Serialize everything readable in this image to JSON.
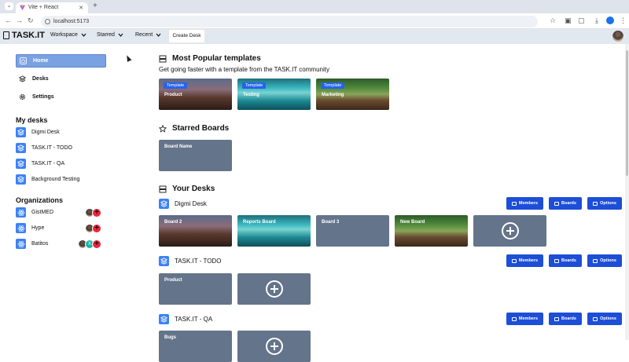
{
  "browser": {
    "tab_title": "Vite + React",
    "url": "localhost:5173"
  },
  "header": {
    "logo": "TASK.IT",
    "menus": [
      {
        "label": "Workspace"
      },
      {
        "label": "Starred"
      },
      {
        "label": "Recent"
      }
    ],
    "create_label": "Create Desk"
  },
  "sidebar": {
    "nav": [
      {
        "label": "Home",
        "icon": "home-icon",
        "active": true
      },
      {
        "label": "Desks",
        "icon": "layers-icon"
      },
      {
        "label": "Settings",
        "icon": "gear-icon"
      }
    ],
    "my_desks_title": "My desks",
    "desks": [
      "Digmi Desk",
      "TASK.IT - TODO",
      "TASK.IT - QA",
      "Background Testing"
    ],
    "orgs_title": "Organizations",
    "orgs": [
      {
        "name": "GistMED"
      },
      {
        "name": "Hype"
      },
      {
        "name": "Batitos",
        "extra_avatar": "X"
      }
    ]
  },
  "main": {
    "popular": {
      "title": "Most Popular templates",
      "subtitle": "Get going faster with a template from the TASK.IT community",
      "badge": "Template",
      "templates": [
        "Product",
        "Testing",
        "Marketing"
      ]
    },
    "starred": {
      "title": "Starred Boards",
      "boards": [
        "Board Name"
      ]
    },
    "your_desks": {
      "title": "Your Desks",
      "buttons": {
        "members": "Members",
        "boards": "Boards",
        "options": "Options"
      },
      "desks": [
        {
          "name": "Digmi Desk",
          "boards": [
            "Board 2",
            "Reports Board",
            "Board 3",
            "New Board"
          ]
        },
        {
          "name": "TASK.IT - TODO",
          "boards": [
            "Product"
          ]
        },
        {
          "name": "TASK.IT - QA",
          "boards": [
            "Bugs"
          ]
        }
      ]
    }
  },
  "colors": {
    "accent": "#1d4ed8",
    "card": "#64748b",
    "active_nav": "#7aa2e3",
    "header": "#e2e8f0"
  }
}
